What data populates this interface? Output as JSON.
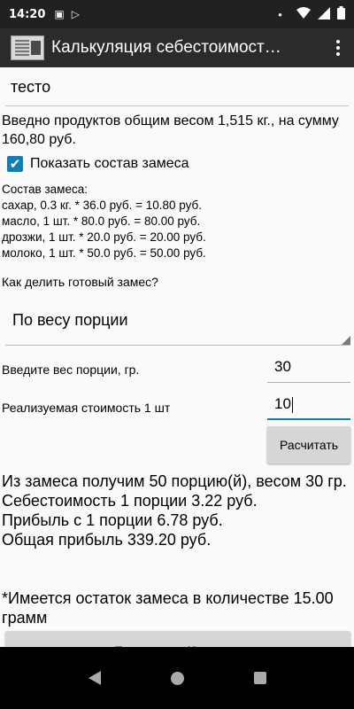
{
  "status_bar": {
    "time": "14:20",
    "icons_left": [
      "image-icon",
      "play-store-icon"
    ],
    "icons_right": [
      "dot-icon",
      "wifi-icon",
      "signal-icon",
      "battery-icon"
    ]
  },
  "action_bar": {
    "title": "Калькуляция себестоимост…",
    "menu_icon": "overflow-menu-icon"
  },
  "form": {
    "name_value": "тесто",
    "summary": "Введно продуктов общим весом 1,515 кг., на сумму 160,80 руб.",
    "show_composition_label": "Показать состав замеса",
    "show_composition_checked": true,
    "composition_header": "Состав замеса:",
    "composition_lines": [
      "сахар, 0.3 кг. * 36.0 руб. = 10.80 руб.",
      "масло, 1 шт. * 80.0 руб. = 80.00 руб.",
      "дрозжи, 1 шт. * 20.0 руб. = 20.00 руб.",
      "молоко, 1 шт. * 50.0 руб. = 50.00 руб."
    ],
    "split_question": "Как делить готовый замес?",
    "split_selected": "По весу порции",
    "weight_label": "Введите вес порции, гр.",
    "weight_value": "30",
    "price_label": "Реализуемая стоимость 1 шт",
    "price_value": "10",
    "calc_button": "Расчитать"
  },
  "results": {
    "line1": "Из замеса получим 50 порцию(й), весом 30 гр.",
    "line2": "Себестоимость 1 порции 3.22 руб.",
    "line3": "Прибыль с 1 порции 6.78 руб.",
    "line4": "Общая прибыль 339.20 руб.",
    "remainder": "*Имеется остаток замеса в количестве 15.00 грамм",
    "bottom_button": "Поделиться (Экспор..."
  },
  "colors": {
    "accent": "#0f7fb8",
    "action_bar": "#2b2b2b",
    "status_bar": "#212121",
    "background": "#fafafa"
  }
}
